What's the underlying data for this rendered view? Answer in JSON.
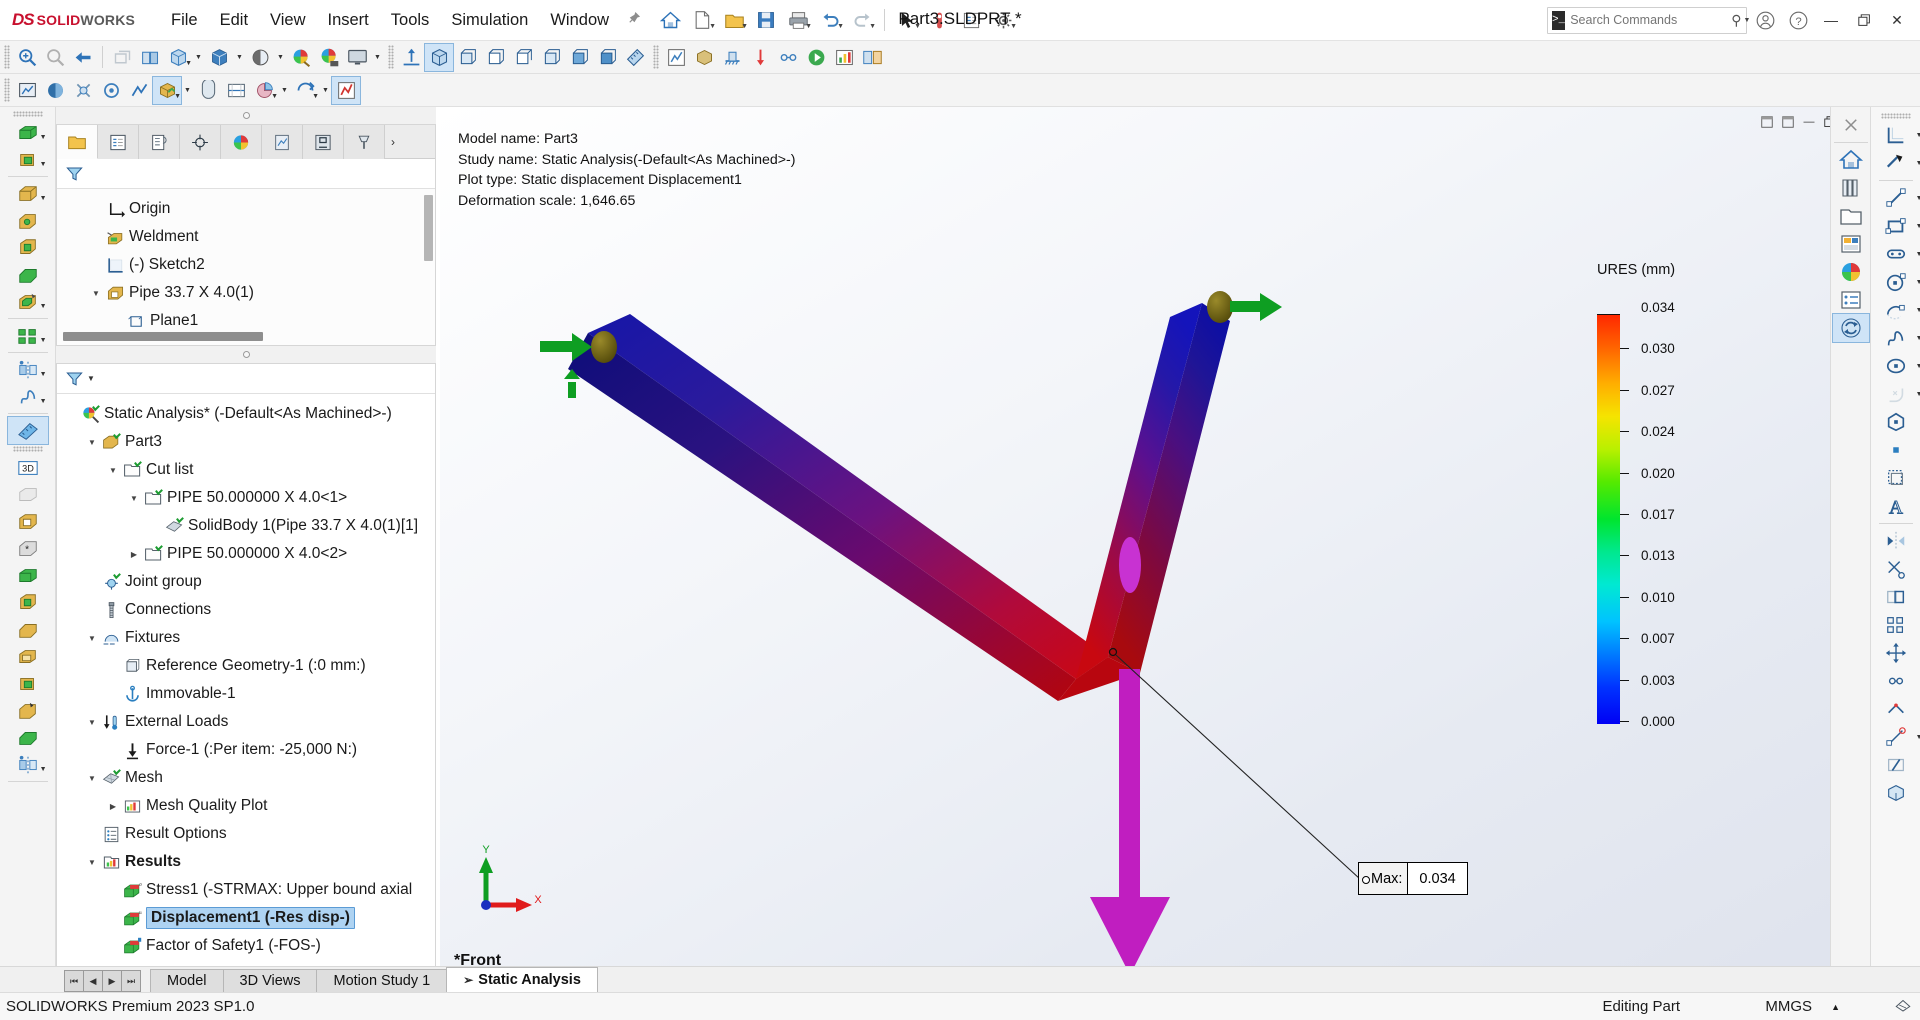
{
  "app": {
    "brand_ds": "DS",
    "brand_solid": "SOLID",
    "brand_works": "WORKS",
    "document_title": "Part3.SLDPRT *",
    "status_product": "SOLIDWORKS Premium 2023 SP1.0",
    "status_mode": "Editing Part",
    "status_units": "MMGS",
    "accent_red": "#c8102e",
    "accent_blue": "#0078d7",
    "selection_blue": "#aed3f2"
  },
  "menu": {
    "items": [
      "File",
      "Edit",
      "View",
      "Insert",
      "Tools",
      "Simulation",
      "Window"
    ],
    "pin_icon": "pushpin-icon"
  },
  "search": {
    "placeholder": "Search Commands",
    "prompt_glyph": ">_",
    "icon": "magnifier-icon",
    "dropdown_icon": "chevron-down-icon"
  },
  "window_controls": {
    "account_icon": "user-account-icon",
    "help_icon": "help-question-icon",
    "minimize": "—",
    "restore": "❐",
    "close": "✕"
  },
  "viewport_controls": {
    "restore_small": "❐",
    "maximize": "□",
    "minimize": "—",
    "close": "✕"
  },
  "feature_tabs": [
    {
      "name": "tab-feature-manager",
      "icon": "yellow-folder-tree-icon",
      "active": true
    },
    {
      "name": "tab-property-manager",
      "icon": "property-list-icon",
      "active": false
    },
    {
      "name": "tab-configuration-manager",
      "icon": "configuration-icon",
      "active": false
    },
    {
      "name": "tab-dimxpert-manager",
      "icon": "target-crosshair-icon",
      "active": false
    },
    {
      "name": "tab-display-manager",
      "icon": "color-sphere-icon",
      "active": false
    },
    {
      "name": "tab-render-manager",
      "icon": "render-page-icon",
      "active": false
    },
    {
      "name": "tab-simulation-manager",
      "icon": "simulation-clamp-icon",
      "active": false
    },
    {
      "name": "tab-cam-manager",
      "icon": "cam-tool-icon",
      "active": false
    }
  ],
  "model_tree": {
    "filter_icon": "funnel-filter-icon",
    "nodes": [
      {
        "label": "Origin",
        "icon": "origin-axes-icon",
        "indent": 1,
        "arrow": "",
        "bold": false,
        "selected": false
      },
      {
        "label": "Weldment",
        "icon": "weldment-icon",
        "indent": 1,
        "arrow": "",
        "bold": false,
        "selected": false
      },
      {
        "label": "(-) Sketch2",
        "icon": "sketch-icon",
        "indent": 1,
        "arrow": "",
        "bold": false,
        "selected": false
      },
      {
        "label": "Pipe 33.7 X 4.0(1)",
        "icon": "structural-member-icon",
        "indent": 1,
        "arrow": "down",
        "bold": false,
        "selected": false
      },
      {
        "label": "Plane1",
        "icon": "plane-icon",
        "indent": 2,
        "arrow": "",
        "bold": false,
        "selected": false
      }
    ]
  },
  "simulation_tree": {
    "filter_icon": "funnel-filter-icon",
    "filter_caret": "chevron-down-icon",
    "nodes": [
      {
        "label": "Static Analysis* (-Default<As Machined>-)",
        "icon": "study-magnifier-icon",
        "indent": 0,
        "arrow": "",
        "bold": false,
        "selected": false
      },
      {
        "label": "Part3",
        "icon": "part-body-icon",
        "indent": 1,
        "arrow": "down",
        "bold": false,
        "selected": false
      },
      {
        "label": "Cut list",
        "icon": "cutlist-folder-icon",
        "indent": 2,
        "arrow": "down",
        "bold": false,
        "selected": false
      },
      {
        "label": "PIPE 50.000000 X 4.0<1>",
        "icon": "cutlist-folder-icon",
        "indent": 3,
        "arrow": "down",
        "bold": false,
        "selected": false
      },
      {
        "label": "SolidBody 1(Pipe 33.7 X 4.0(1)[1]",
        "icon": "solid-body-icon",
        "indent": 4,
        "arrow": "",
        "bold": false,
        "selected": false
      },
      {
        "label": "PIPE 50.000000 X 4.0<2>",
        "icon": "cutlist-folder-icon",
        "indent": 3,
        "arrow": "right",
        "bold": false,
        "selected": false
      },
      {
        "label": "Joint group",
        "icon": "joint-group-icon",
        "indent": 1,
        "arrow": "",
        "bold": false,
        "selected": false
      },
      {
        "label": "Connections",
        "icon": "connections-bolt-icon",
        "indent": 1,
        "arrow": "",
        "bold": false,
        "selected": false
      },
      {
        "label": "Fixtures",
        "icon": "fixtures-icon",
        "indent": 1,
        "arrow": "down",
        "bold": false,
        "selected": false
      },
      {
        "label": "Reference Geometry-1 (:0 mm:)",
        "icon": "reference-geometry-icon",
        "indent": 2,
        "arrow": "",
        "bold": false,
        "selected": false
      },
      {
        "label": "Immovable-1",
        "icon": "immovable-anchor-icon",
        "indent": 2,
        "arrow": "",
        "bold": false,
        "selected": false
      },
      {
        "label": "External Loads",
        "icon": "external-loads-icon",
        "indent": 1,
        "arrow": "down",
        "bold": false,
        "selected": false
      },
      {
        "label": "Force-1 (:Per item: -25,000 N:)",
        "icon": "force-arrow-icon",
        "indent": 2,
        "arrow": "",
        "bold": false,
        "selected": false
      },
      {
        "label": "Mesh",
        "icon": "mesh-icon",
        "indent": 1,
        "arrow": "down",
        "bold": false,
        "selected": false
      },
      {
        "label": "Mesh Quality Plot",
        "icon": "mesh-quality-plot-icon",
        "indent": 2,
        "arrow": "right",
        "bold": false,
        "selected": false
      },
      {
        "label": "Result Options",
        "icon": "result-options-icon",
        "indent": 1,
        "arrow": "",
        "bold": false,
        "selected": false
      },
      {
        "label": "Results",
        "icon": "results-folder-icon",
        "indent": 1,
        "arrow": "down",
        "bold": true,
        "selected": false
      },
      {
        "label": "Stress1 (-STRMAX: Upper bound axial",
        "icon": "stress-plot-icon",
        "indent": 2,
        "arrow": "",
        "bold": false,
        "selected": false
      },
      {
        "label": "Displacement1 (-Res disp-)",
        "icon": "displacement-plot-icon",
        "indent": 2,
        "arrow": "",
        "bold": true,
        "selected": true
      },
      {
        "label": "Factor of Safety1 (-FOS-)",
        "icon": "fos-plot-icon",
        "indent": 2,
        "arrow": "",
        "bold": false,
        "selected": false
      }
    ]
  },
  "plot_info": {
    "model_name": "Model name: Part3",
    "study_name": "Study name: Static Analysis(-Default<As Machined>-)",
    "plot_type": "Plot type: Static displacement Displacement1",
    "deformation_scale": "Deformation scale: 1,646.65"
  },
  "chart_data": {
    "type": "heatmap",
    "title": "URES (mm)",
    "legend_title": "URES (mm)",
    "legend_position": "right",
    "unit": "mm",
    "quantity": "URES",
    "tick_values": [
      "0.034",
      "0.030",
      "0.027",
      "0.024",
      "0.020",
      "0.017",
      "0.013",
      "0.010",
      "0.007",
      "0.003",
      "0.000"
    ],
    "values": [
      0.034,
      0.03,
      0.027,
      0.024,
      0.02,
      0.017,
      0.013,
      0.01,
      0.007,
      0.003,
      0.0
    ],
    "range": [
      0.0,
      0.034
    ],
    "colormap": [
      "#0000f4",
      "#0033ff",
      "#007bff",
      "#00c3ff",
      "#00e9d2",
      "#00e88e",
      "#00e52e",
      "#55ea00",
      "#b9f000",
      "#f5e400",
      "#ffae00",
      "#ff6a00",
      "#ff2600"
    ],
    "max_label": "Max:",
    "max_value": "0.034",
    "annotations": [
      "Max: 0.034"
    ]
  },
  "triad": {
    "x_label": "X",
    "y_label": "Y",
    "x_color": "#e01b1b",
    "y_color": "#0e9e22"
  },
  "view_label": "*Front",
  "document_tabs": {
    "nav": [
      "first-record-icon",
      "previous-record-icon",
      "next-record-icon",
      "last-record-icon"
    ],
    "items": [
      {
        "label": "Model",
        "active": false,
        "flag": ""
      },
      {
        "label": "3D Views",
        "active": false,
        "flag": ""
      },
      {
        "label": "Motion Study 1",
        "active": false,
        "flag": ""
      },
      {
        "label": "Static Analysis",
        "active": true,
        "flag": "study-flag-icon"
      }
    ]
  },
  "toolbar_row1": [
    {
      "name": "zoom-to-fit-icon",
      "glyph": "zoomfit"
    },
    {
      "name": "zoom-to-area-icon",
      "glyph": "zoomarea"
    },
    {
      "name": "previous-view-icon",
      "glyph": "prevview"
    },
    {
      "name": "section-view-icon",
      "glyph": "sectionghost"
    },
    {
      "name": "view-orientation-icon",
      "glyph": "vieworient"
    },
    {
      "name": "display-style-icon",
      "glyph": "displaystyle",
      "caret": true
    },
    {
      "name": "hide-show-items-icon",
      "glyph": "cube3d",
      "caret": true
    },
    {
      "name": "edit-appearance-icon",
      "glyph": "sphereshade",
      "caret": true
    },
    {
      "name": "apply-scene-icon",
      "glyph": "paintball"
    },
    {
      "name": "view-settings-icon",
      "glyph": "paintball2"
    },
    {
      "name": "display-monitor-icon",
      "glyph": "monitor",
      "caret": true
    }
  ],
  "toolbar_row1b": [
    {
      "name": "normal-to-icon",
      "glyph": "normalto"
    },
    {
      "name": "isometric-view-icon",
      "glyph": "cubeiso",
      "active": true
    },
    {
      "name": "front-view-icon",
      "glyph": "cubefront"
    },
    {
      "name": "left-view-icon",
      "glyph": "cubeleft"
    },
    {
      "name": "right-view-icon",
      "glyph": "cuberight"
    },
    {
      "name": "top-view-icon",
      "glyph": "cubetop"
    },
    {
      "name": "bottom-view-icon",
      "glyph": "cubebottom"
    },
    {
      "name": "back-view-icon",
      "glyph": "cubeback"
    },
    {
      "name": "trimetric-view-icon",
      "glyph": "cubetri"
    },
    {
      "name": "measure-icon",
      "glyph": "measure"
    }
  ],
  "toolbar_row1c": [
    {
      "name": "simulation-study-icon",
      "glyph": "studyicon"
    },
    {
      "name": "apply-material-icon",
      "glyph": "material"
    },
    {
      "name": "fixtures-advisor-icon",
      "glyph": "fixadvisor"
    },
    {
      "name": "external-loads-advisor-icon",
      "glyph": "loadadvisor"
    },
    {
      "name": "connections-advisor-icon",
      "glyph": "connadvisor"
    },
    {
      "name": "run-study-icon",
      "glyph": "runstudy"
    },
    {
      "name": "results-advisor-icon",
      "glyph": "resadvisor"
    },
    {
      "name": "compare-results-icon",
      "glyph": "compareres"
    }
  ],
  "toolbar_row2": [
    {
      "name": "new-study-icon",
      "glyph": "newstudy"
    },
    {
      "name": "apply-material-2-icon",
      "glyph": "mat2"
    },
    {
      "name": "fixture-2-icon",
      "glyph": "fix2"
    },
    {
      "name": "load-2-icon",
      "glyph": "load2"
    },
    {
      "name": "connection-2-icon",
      "glyph": "conn2"
    },
    {
      "name": "mesh-run-icon",
      "glyph": "meshrun",
      "active": true,
      "caret": true
    },
    {
      "name": "result-advisor-2-icon",
      "glyph": "resadv2"
    },
    {
      "name": "plot-tools-icon",
      "glyph": "plottools"
    },
    {
      "name": "report-icon",
      "glyph": "report",
      "caret": true
    },
    {
      "name": "include-image-icon",
      "glyph": "incimg",
      "caret": true
    },
    {
      "name": "simulation-options-icon",
      "glyph": "simopts",
      "active": true
    }
  ],
  "left_toolbar": [
    {
      "name": "extruded-boss-icon",
      "glyph": "extrudeboss",
      "caret": true
    },
    {
      "name": "revolved-boss-icon",
      "glyph": "revolveboss",
      "caret": true
    },
    {
      "name": "extruded-cut-icon",
      "glyph": "extrudecut",
      "caret": true
    },
    {
      "name": "hole-wizard-icon",
      "glyph": "holewizard"
    },
    {
      "name": "revolved-cut-icon",
      "glyph": "revolvecut"
    },
    {
      "name": "swept-boss-icon",
      "glyph": "sweptboss"
    },
    {
      "name": "lofted-boss-icon",
      "glyph": "loftedboss",
      "caret": true
    },
    {
      "name": "linear-pattern-icon",
      "glyph": "linearpattern",
      "caret": true
    },
    {
      "name": "mirror-icon",
      "glyph": "mirror",
      "caret": true
    },
    {
      "name": "curves-icon",
      "glyph": "curves",
      "caret": true
    },
    {
      "name": "reference-geometry-2-icon",
      "glyph": "refgeo",
      "active": true
    }
  ],
  "left_toolbar2": [
    {
      "name": "3d-sketch-icon",
      "glyph": "sketch3d"
    },
    {
      "name": "weldment-toolbar-icon",
      "glyph": "weldtb"
    },
    {
      "name": "structural-member-icon",
      "glyph": "structmem"
    },
    {
      "name": "trim-extend-icon",
      "glyph": "trimext"
    },
    {
      "name": "end-cap-icon",
      "glyph": "endcap"
    },
    {
      "name": "gusset-icon",
      "glyph": "gusset"
    },
    {
      "name": "fillet-bead-icon",
      "glyph": "filletbead"
    },
    {
      "name": "weld-bead-icon",
      "glyph": "weldbead"
    },
    {
      "name": "sheet-metal-icon",
      "glyph": "sheetmetal"
    },
    {
      "name": "weldment-cutlist-icon",
      "glyph": "wcutlist"
    },
    {
      "name": "chamfer-icon",
      "glyph": "chamfer"
    },
    {
      "name": "mirror-2-icon",
      "glyph": "mirror2",
      "caret": true
    }
  ],
  "right_toolbar_views": [
    {
      "name": "close-viewport-icon",
      "glyph": "x"
    },
    {
      "name": "home-view-icon",
      "glyph": "home"
    },
    {
      "name": "appearances-library-icon",
      "glyph": "books"
    },
    {
      "name": "file-explorer-icon",
      "glyph": "folder"
    },
    {
      "name": "view-palette-icon",
      "glyph": "palette"
    },
    {
      "name": "appearances-scenes-icon",
      "glyph": "sphere"
    },
    {
      "name": "custom-properties-icon",
      "glyph": "proplist"
    },
    {
      "name": "pdm-icon",
      "glyph": "refresh",
      "active": true
    }
  ],
  "right_toolbar_sketch": [
    {
      "name": "sketch-tool-icon",
      "glyph": "sketchgrid",
      "caret": true
    },
    {
      "name": "smart-dimension-icon",
      "glyph": "smartdim",
      "caret": true
    },
    {
      "name": "line-icon",
      "glyph": "line",
      "caret": true
    },
    {
      "name": "rectangle-icon",
      "glyph": "rect",
      "caret": true
    },
    {
      "name": "slot-icon",
      "glyph": "slot",
      "caret": true
    },
    {
      "name": "circle-icon",
      "glyph": "circle",
      "caret": true
    },
    {
      "name": "arc-icon",
      "glyph": "arc",
      "caret": true
    },
    {
      "name": "spline-icon",
      "glyph": "spline",
      "caret": true
    },
    {
      "name": "ellipse-icon",
      "glyph": "ellipse",
      "caret": true
    },
    {
      "name": "fillet-icon",
      "glyph": "sfillet",
      "caret": true
    },
    {
      "name": "polygon-icon",
      "glyph": "polygon"
    },
    {
      "name": "point-icon",
      "glyph": "point"
    },
    {
      "name": "offset-entities-icon",
      "glyph": "offsetent"
    },
    {
      "name": "text-icon",
      "glyph": "textA"
    },
    {
      "name": "mirror-entities-icon",
      "glyph": "mirrorent"
    },
    {
      "name": "trim-entities-icon",
      "glyph": "trimentities"
    },
    {
      "name": "convert-entities-icon",
      "glyph": "convertent"
    },
    {
      "name": "linear-sketch-pattern-icon",
      "glyph": "sketchpat"
    },
    {
      "name": "move-entities-icon",
      "glyph": "moveent"
    },
    {
      "name": "display-delete-relations-icon",
      "glyph": "relations"
    },
    {
      "name": "repair-sketch-icon",
      "glyph": "repair"
    },
    {
      "name": "quick-snaps-icon",
      "glyph": "snaps",
      "caret": true
    },
    {
      "name": "rapid-sketch-icon",
      "glyph": "rapid"
    },
    {
      "name": "instant3d-icon",
      "glyph": "instant3d"
    }
  ]
}
